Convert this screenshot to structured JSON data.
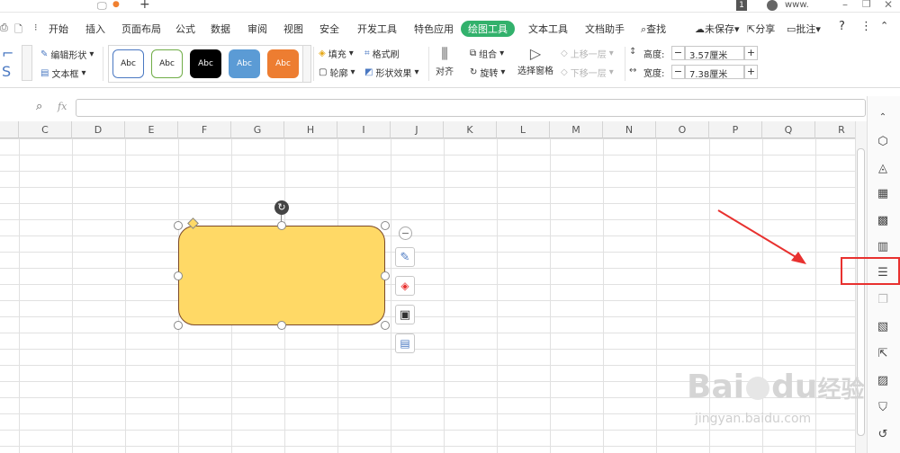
{
  "titlebar": {
    "tab_plus": "+",
    "page_num": "1",
    "account": "www."
  },
  "menu": {
    "items": [
      "开始",
      "插入",
      "页面布局",
      "公式",
      "数据",
      "审阅",
      "视图",
      "安全",
      "开发工具",
      "特色应用",
      "绘图工具",
      "文本工具",
      "文档助手",
      "查找"
    ],
    "active": "绘图工具",
    "unsaved": "未保存",
    "share": "分享",
    "comment": "批注",
    "help": "?"
  },
  "ribbon": {
    "edit_shape": "编辑形状",
    "textbox": "文本框",
    "styles": [
      "Abc",
      "Abc",
      "Abc",
      "Abc",
      "Abc"
    ],
    "fill": "填充",
    "format_brush": "格式刷",
    "outline": "轮廓",
    "shape_effects": "形状效果",
    "align": "对齐",
    "group": "组合",
    "rotate": "旋转",
    "selection_pane": "选择窗格",
    "bring_forward": "上移一层",
    "send_backward": "下移一层",
    "height_label": "高度:",
    "height_value": "3.57厘米",
    "width_label": "宽度:",
    "width_value": "7.38厘米"
  },
  "formula": {
    "fx": "fx",
    "value": ""
  },
  "columns": [
    "C",
    "D",
    "E",
    "F",
    "G",
    "H",
    "I",
    "J",
    "K",
    "L",
    "M",
    "N",
    "O",
    "P",
    "Q",
    "R"
  ],
  "colors": {
    "accent": "#32b16c",
    "shape_fill": "#ffd966",
    "highlight": "#e8312f"
  },
  "sidebar_icons": [
    "shapes-icon",
    "fill-icon",
    "table-icon",
    "grid-icon",
    "chart-icon",
    "properties-icon",
    "copy-icon",
    "image-gallery-icon",
    "export-icon",
    "picture-icon",
    "shield-icon",
    "history-icon"
  ],
  "watermark": {
    "brand": "Bai",
    "brand_mid": "du",
    "brand_cn": "经验",
    "url": "jingyan.baidu.com"
  }
}
